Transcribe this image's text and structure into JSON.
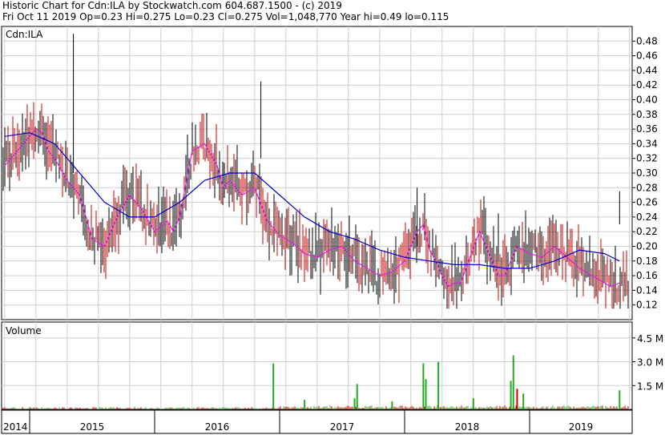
{
  "header": {
    "line1": "Historic Chart for Cdn:ILA by Stockwatch.com 604.687.1500 - (c) 2019",
    "line2": "Fri Oct 11 2019  Op=0.23  Hi=0.275  Lo=0.23  Cl=0.275  Vol=1,048,770  Year hi=0.49  lo=0.115"
  },
  "colors": {
    "up_candle": "#000000",
    "down_candle": "#cc0000",
    "ma_short": "#e020e0",
    "ma_long": "#0000cc",
    "volume_up": "#22aa22",
    "volume_down": "#cc0000",
    "grid": "#cfcfcf"
  },
  "chart_data": [
    {
      "type": "candlestick",
      "label": "Cdn:ILA",
      "ylim": [
        0.1,
        0.5
      ],
      "y_ticks": [
        "0.12",
        "0.14",
        "0.16",
        "0.18",
        "0.20",
        "0.22",
        "0.24",
        "0.26",
        "0.28",
        "0.30",
        "0.32",
        "0.34",
        "0.36",
        "0.38",
        "0.40",
        "0.42",
        "0.44",
        "0.46",
        "0.48"
      ],
      "x_labels": [
        "2014",
        "2015",
        "2016",
        "2017",
        "2018",
        "2019"
      ],
      "grid": true,
      "series": [
        {
          "name": "",
          "line_type": "short moving average",
          "x": [
            2014.8,
            2014.9,
            2015.0,
            2015.05,
            2015.1,
            2015.15,
            2015.2,
            2015.3,
            2015.4,
            2015.5,
            2015.6,
            2015.65,
            2015.7,
            2015.8,
            2015.9,
            2016.0,
            2016.1,
            2016.15,
            2016.2,
            2016.3,
            2016.4,
            2016.5,
            2016.55,
            2016.6,
            2016.7,
            2016.8,
            2016.9,
            2017.0,
            2017.1,
            2017.2,
            2017.3,
            2017.4,
            2017.5,
            2017.6,
            2017.7,
            2017.8,
            2017.9,
            2018.0,
            2018.1,
            2018.15,
            2018.2,
            2018.25,
            2018.3,
            2018.35,
            2018.4,
            2018.45,
            2018.5,
            2018.6,
            2018.65,
            2018.7,
            2018.75,
            2018.8,
            2018.9,
            2019.0,
            2019.1,
            2019.2,
            2019.3,
            2019.4,
            2019.5,
            2019.6,
            2019.65,
            2019.72
          ],
          "values": [
            0.31,
            0.33,
            0.35,
            0.36,
            0.355,
            0.33,
            0.32,
            0.29,
            0.27,
            0.21,
            0.2,
            0.22,
            0.24,
            0.27,
            0.25,
            0.22,
            0.235,
            0.22,
            0.24,
            0.33,
            0.34,
            0.31,
            0.28,
            0.29,
            0.27,
            0.28,
            0.235,
            0.215,
            0.205,
            0.19,
            0.185,
            0.195,
            0.2,
            0.18,
            0.17,
            0.16,
            0.165,
            0.18,
            0.22,
            0.23,
            0.195,
            0.18,
            0.16,
            0.145,
            0.15,
            0.15,
            0.175,
            0.22,
            0.2,
            0.18,
            0.16,
            0.16,
            0.2,
            0.19,
            0.185,
            0.2,
            0.185,
            0.17,
            0.16,
            0.15,
            0.145,
            0.15
          ]
        },
        {
          "name": "",
          "line_type": "long moving average",
          "x": [
            2014.8,
            2015.0,
            2015.2,
            2015.4,
            2015.6,
            2015.8,
            2016.0,
            2016.2,
            2016.4,
            2016.6,
            2016.8,
            2017.0,
            2017.2,
            2017.4,
            2017.6,
            2017.8,
            2018.0,
            2018.2,
            2018.4,
            2018.6,
            2018.8,
            2019.0,
            2019.2,
            2019.4,
            2019.6,
            2019.72
          ],
          "values": [
            0.35,
            0.355,
            0.34,
            0.3,
            0.26,
            0.24,
            0.24,
            0.26,
            0.29,
            0.3,
            0.3,
            0.27,
            0.24,
            0.22,
            0.21,
            0.195,
            0.185,
            0.18,
            0.175,
            0.175,
            0.17,
            0.17,
            0.18,
            0.195,
            0.19,
            0.18
          ]
        }
      ]
    },
    {
      "type": "bar",
      "label": "Volume",
      "ylim": [
        0,
        5.5
      ],
      "y_ticks": [
        "1.5 M",
        "3.0 M",
        "4.5 M"
      ],
      "spikes": [
        {
          "x": 2016.95,
          "value": 2.9,
          "dir": "up"
        },
        {
          "x": 2017.2,
          "value": 0.6,
          "dir": "up"
        },
        {
          "x": 2017.6,
          "value": 0.7,
          "dir": "up"
        },
        {
          "x": 2017.62,
          "value": 1.6,
          "dir": "up"
        },
        {
          "x": 2017.9,
          "value": 0.5,
          "dir": "up"
        },
        {
          "x": 2018.15,
          "value": 2.9,
          "dir": "up"
        },
        {
          "x": 2018.17,
          "value": 1.9,
          "dir": "up"
        },
        {
          "x": 2018.27,
          "value": 3.0,
          "dir": "up"
        },
        {
          "x": 2018.55,
          "value": 0.7,
          "dir": "up"
        },
        {
          "x": 2018.85,
          "value": 1.8,
          "dir": "up"
        },
        {
          "x": 2018.87,
          "value": 3.4,
          "dir": "up"
        },
        {
          "x": 2018.9,
          "value": 1.3,
          "dir": "down"
        },
        {
          "x": 2018.95,
          "value": 1.0,
          "dir": "up"
        },
        {
          "x": 2019.72,
          "value": 1.2,
          "dir": "up"
        }
      ]
    }
  ]
}
